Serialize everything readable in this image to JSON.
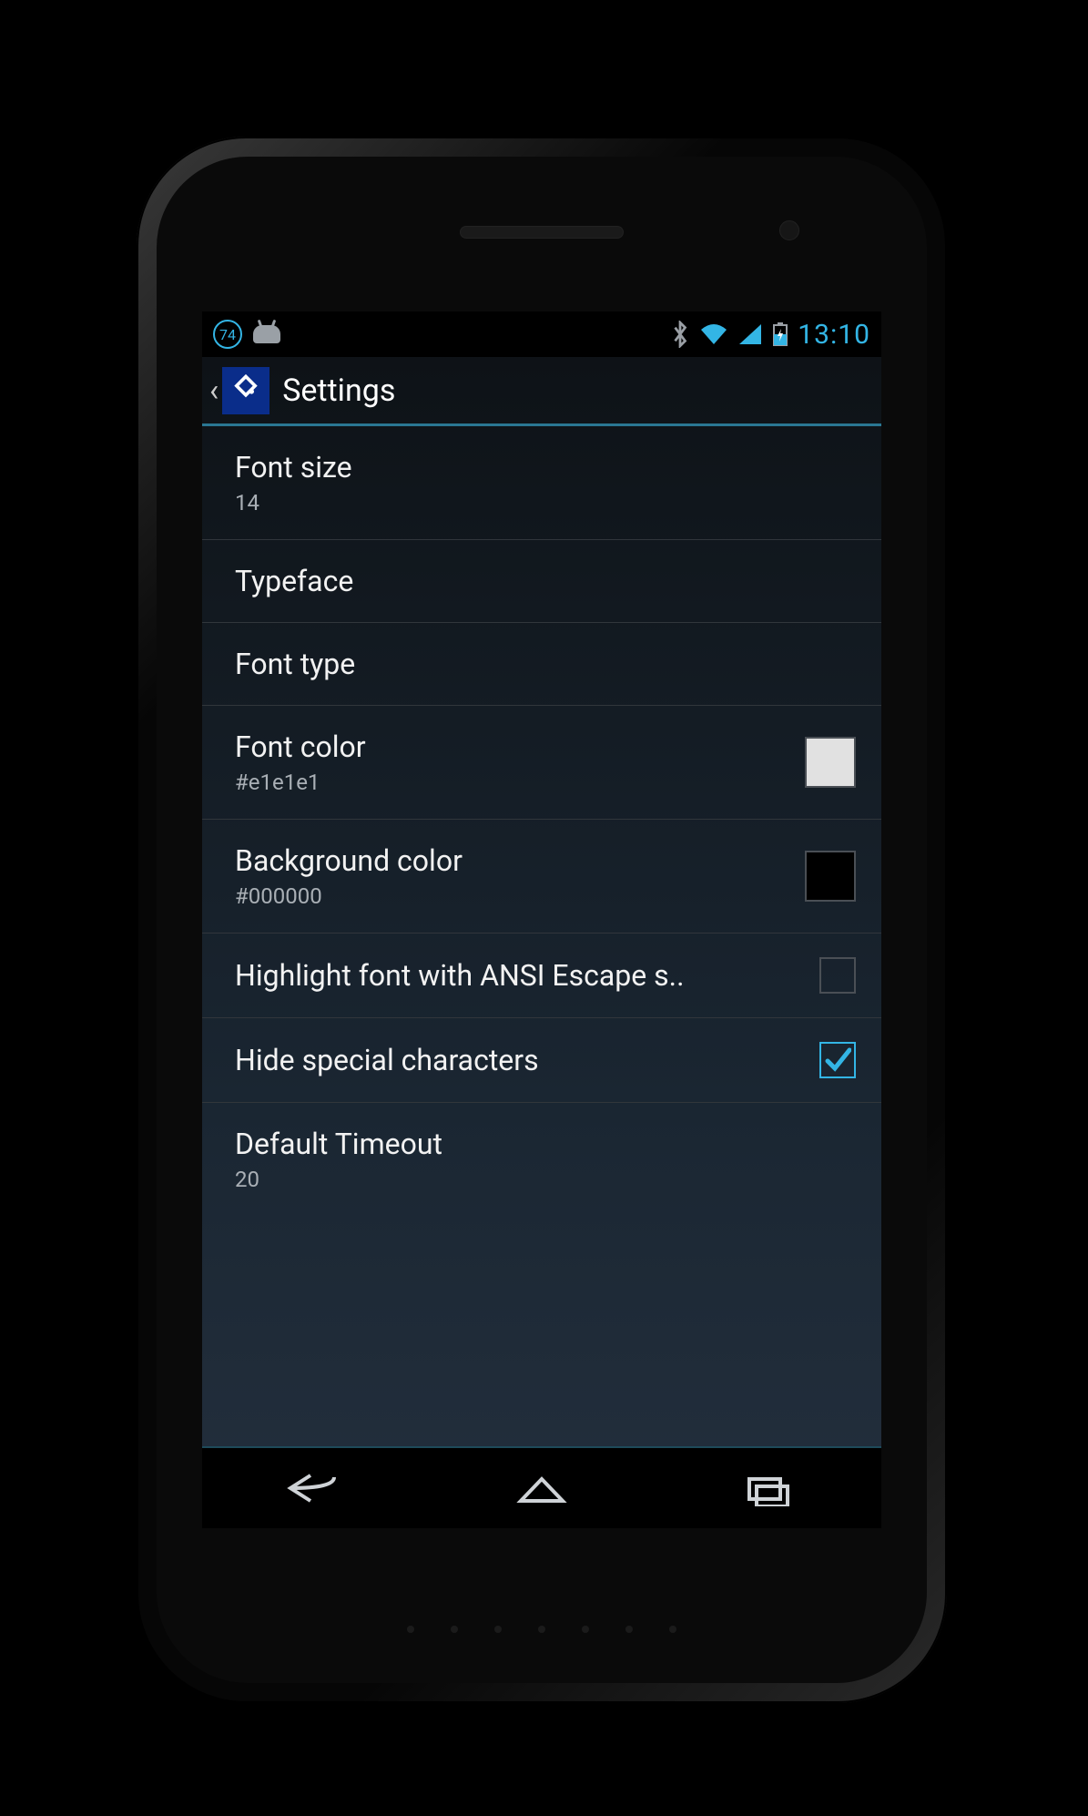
{
  "statusbar": {
    "battery_badge": "74",
    "time": "13:10"
  },
  "actionbar": {
    "title": "Settings"
  },
  "settings": {
    "font_size": {
      "title": "Font size",
      "value": "14"
    },
    "typeface": {
      "title": "Typeface"
    },
    "font_type": {
      "title": "Font type"
    },
    "font_color": {
      "title": "Font color",
      "value": "#e1e1e1",
      "swatch": "#e1e1e1"
    },
    "background_color": {
      "title": "Background color",
      "value": "#000000",
      "swatch": "#000000"
    },
    "ansi_highlight": {
      "title": "Highlight font with ANSI Escape s..",
      "checked": false
    },
    "hide_special": {
      "title": "Hide special characters",
      "checked": true
    },
    "default_timeout": {
      "title": "Default Timeout",
      "value": "20"
    }
  }
}
